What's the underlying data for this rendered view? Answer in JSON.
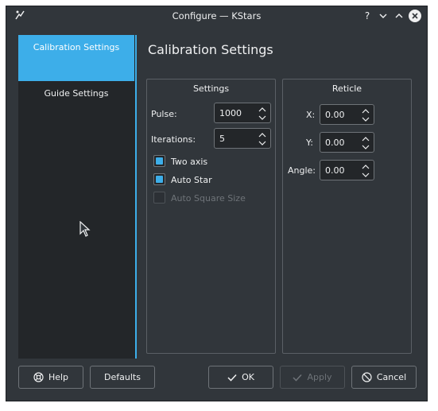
{
  "window": {
    "title": "Configure — KStars"
  },
  "titlebar": {
    "help_glyph": "?"
  },
  "sidebar": {
    "items": [
      {
        "label": "Calibration Settings",
        "active": true
      },
      {
        "label": "Guide Settings",
        "active": false
      }
    ]
  },
  "page": {
    "title": "Calibration Settings"
  },
  "settings_group": {
    "title": "Settings",
    "pulse": {
      "label": "Pulse:",
      "value": "1000"
    },
    "iterations": {
      "label": "Iterations:",
      "value": "5"
    },
    "two_axis": {
      "label": "Two axis",
      "checked": true
    },
    "auto_star": {
      "label": "Auto Star",
      "checked": true
    },
    "auto_square_size": {
      "label": "Auto Square Size",
      "checked": false,
      "disabled": true
    }
  },
  "reticle_group": {
    "title": "Reticle",
    "x": {
      "label": "X:",
      "value": "0.00"
    },
    "y": {
      "label": "Y:",
      "value": "0.00"
    },
    "angle": {
      "label": "Angle:",
      "value": "0.00"
    }
  },
  "buttons": {
    "help": "Help",
    "defaults": "Defaults",
    "ok": "OK",
    "apply": "Apply",
    "cancel": "Cancel"
  },
  "colors": {
    "accent": "#3daee9",
    "window_bg": "#31363b",
    "view_bg": "#232629",
    "text": "#eff0f1"
  },
  "icons": [
    "kstars-app-icon",
    "help-icon",
    "minimize-icon",
    "maximize-icon",
    "close-icon",
    "lifebuoy-icon",
    "checkmark-icon",
    "cancel-icon",
    "mouse-cursor-icon"
  ]
}
